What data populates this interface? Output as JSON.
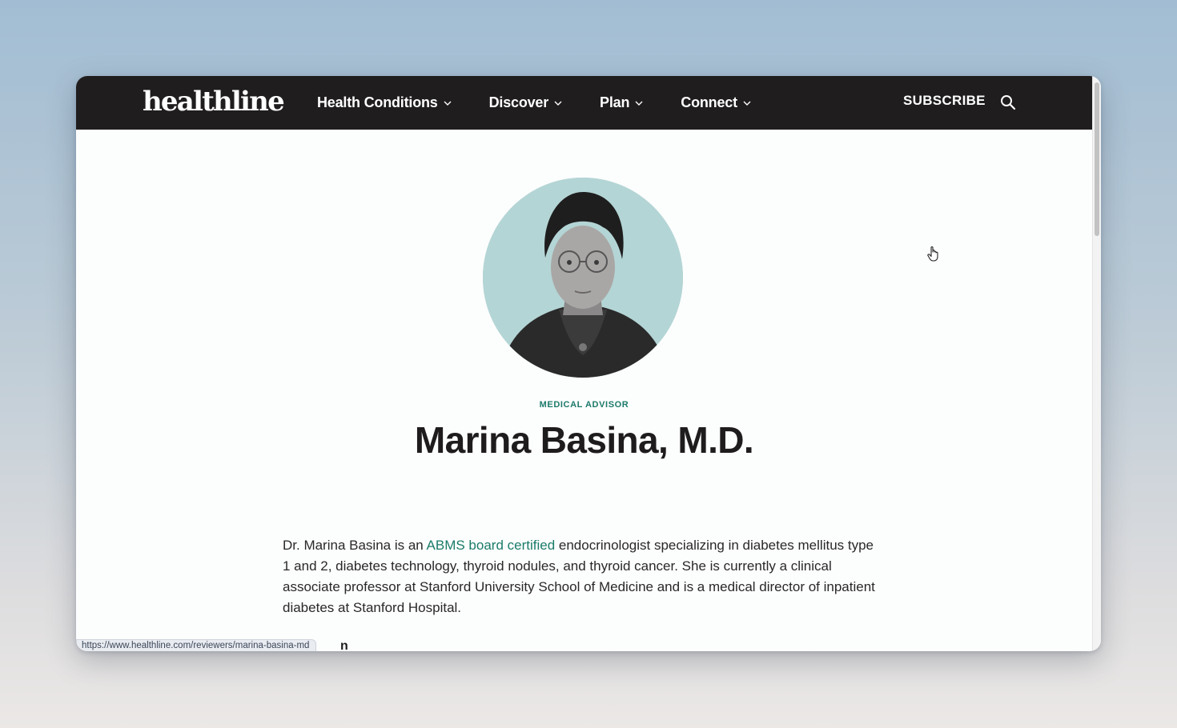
{
  "nav": {
    "logo": "healthline",
    "items": [
      {
        "label": "Health Conditions"
      },
      {
        "label": "Discover"
      },
      {
        "label": "Plan"
      },
      {
        "label": "Connect"
      }
    ],
    "subscribe_label": "SUBSCRIBE",
    "search_icon": "search-icon"
  },
  "profile": {
    "role": "MEDICAL ADVISOR",
    "name": "Marina Basina, M.D.",
    "bio_before": "Dr. Marina Basina is an ",
    "bio_link": "ABMS board certified",
    "bio_after": " endocrinologist specializing in diabetes mellitus type 1 and 2, diabetes technology, thyroid nodules, and thyroid cancer. She is currently a clinical associate professor at Stanford University School of Medicine and is a medical director of inpatient diabetes at Stanford Hospital."
  },
  "status_bar": {
    "url": "https://www.healthline.com/reviewers/marina-basina-md",
    "peek_text": "n"
  },
  "colors": {
    "nav_bg": "#201d1e",
    "accent": "#1b7c6a",
    "avatar_bg": "#b4d5d5"
  }
}
